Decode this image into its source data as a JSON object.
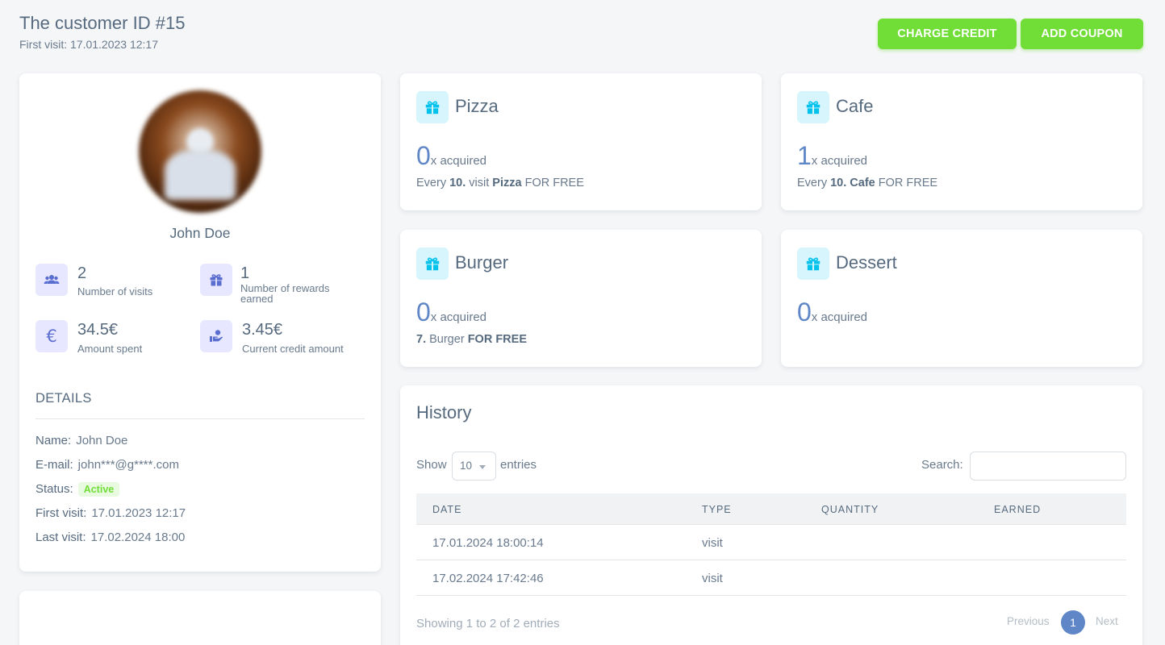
{
  "header": {
    "title": "The customer ID #15",
    "subtitle": "First visit: 17.01.2023 12:17",
    "charge_label": "CHARGE CREDIT",
    "coupon_label": "ADD COUPON"
  },
  "profile": {
    "name": "John Doe",
    "stats": [
      {
        "value": "2",
        "label": "Number of visits",
        "icon": "users-icon"
      },
      {
        "value": "1",
        "label": "Number of rewards earned",
        "icon": "gift-icon"
      },
      {
        "value": "34.5€",
        "label": "Amount spent",
        "icon": "euro-icon"
      },
      {
        "value": "3.45€",
        "label": "Current credit amount",
        "icon": "hand-coin-icon"
      }
    ],
    "details_heading": "DETAILS",
    "details": {
      "name_key": "Name:",
      "name_val": "John Doe",
      "email_key": "E-mail:",
      "email_val": "john***@g****.com",
      "status_key": "Status:",
      "status_val": "Active",
      "first_key": "First visit:",
      "first_val": "17.01.2023 12:17",
      "last_key": "Last visit:",
      "last_val": "17.02.2024 18:00"
    }
  },
  "rewards": [
    {
      "title": "Pizza",
      "count": "0",
      "suffix": "x acquired",
      "desc_pre": "Every ",
      "desc_bold1": "10.",
      "desc_mid": " visit ",
      "desc_bold2": "Pizza",
      "desc_post": " FOR FREE"
    },
    {
      "title": "Cafe",
      "count": "1",
      "suffix": "x acquired",
      "desc_pre": "Every ",
      "desc_bold1": "10. Cafe",
      "desc_mid": "",
      "desc_bold2": "",
      "desc_post": " FOR FREE"
    },
    {
      "title": "Burger",
      "count": "0",
      "suffix": "x acquired",
      "desc_pre": "",
      "desc_bold1": "7.",
      "desc_mid": " Burger ",
      "desc_bold2": "FOR FREE",
      "desc_post": ""
    },
    {
      "title": "Dessert",
      "count": "0",
      "suffix": "x acquired",
      "desc_pre": "",
      "desc_bold1": "",
      "desc_mid": "",
      "desc_bold2": "",
      "desc_post": ""
    }
  ],
  "history": {
    "title": "History",
    "show_label": "Show",
    "page_length": "10",
    "entries_label": "entries",
    "search_label": "Search:",
    "search_value": "",
    "columns": [
      "DATE",
      "TYPE",
      "QUANTITY",
      "EARNED"
    ],
    "rows": [
      {
        "date": "17.01.2024 18:00:14",
        "type": "visit",
        "quantity": "",
        "earned": ""
      },
      {
        "date": "17.02.2024 17:42:46",
        "type": "visit",
        "quantity": "",
        "earned": ""
      }
    ],
    "info": "Showing 1 to 2 of 2 entries",
    "prev_label": "Previous",
    "current_page": "1",
    "next_label": "Next"
  },
  "colors": {
    "accent_green": "#71dd37",
    "accent_blue": "#5f87c7",
    "icon_bg": "#e7e7ff",
    "gift_bg": "#d7f5fc"
  }
}
